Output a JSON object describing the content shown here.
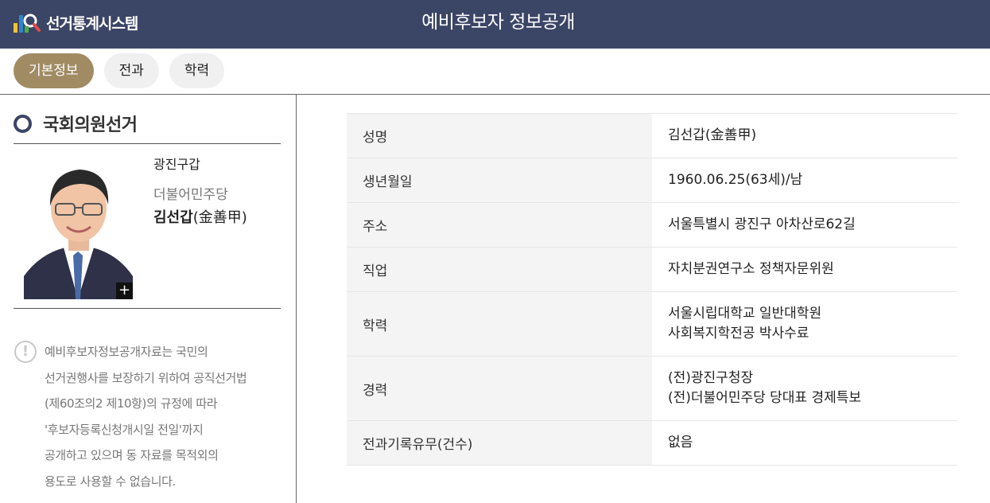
{
  "header": {
    "logo_text": "선거통계시스템",
    "page_title": "예비후보자 정보공개",
    "colors": {
      "bar": "#3b4566",
      "accent": "#a08b63"
    }
  },
  "tabs": [
    {
      "label": "기본정보",
      "active": true
    },
    {
      "label": "전과",
      "active": false
    },
    {
      "label": "학력",
      "active": false
    }
  ],
  "sidebar": {
    "section_title": "국회의원선거",
    "district": "광진구갑",
    "party": "더불어민주당",
    "name_ko": "김선갑",
    "name_hanja": "(金善甲)",
    "zoom_icon": "plus-icon",
    "notice_icon": "exclamation-icon",
    "notice_lines": [
      "예비후보자정보공개자료는 국민의",
      "선거권행사를 보장하기 위하여 공직선거법",
      "(제60조의2 제10항)의 규정에 따라",
      "'후보자등록신청개시일 전일'까지",
      "공개하고 있으며 동 자료를 목적외의",
      "용도로 사용할 수 없습니다."
    ]
  },
  "info_table": [
    {
      "label": "성명",
      "values": [
        "김선갑(金善甲)"
      ]
    },
    {
      "label": "생년월일",
      "values": [
        "1960.06.25(63세)/남"
      ]
    },
    {
      "label": "주소",
      "values": [
        "서울특별시 광진구 아차산로62길"
      ]
    },
    {
      "label": "직업",
      "values": [
        "자치분권연구소 정책자문위원"
      ]
    },
    {
      "label": "학력",
      "values": [
        "서울시립대학교 일반대학원",
        "사회복지학전공 박사수료"
      ]
    },
    {
      "label": "경력",
      "values": [
        "(전)광진구청장",
        "(전)더불어민주당 당대표 경제특보"
      ]
    },
    {
      "label": "전과기록유무(건수)",
      "values": [
        "없음"
      ]
    }
  ]
}
